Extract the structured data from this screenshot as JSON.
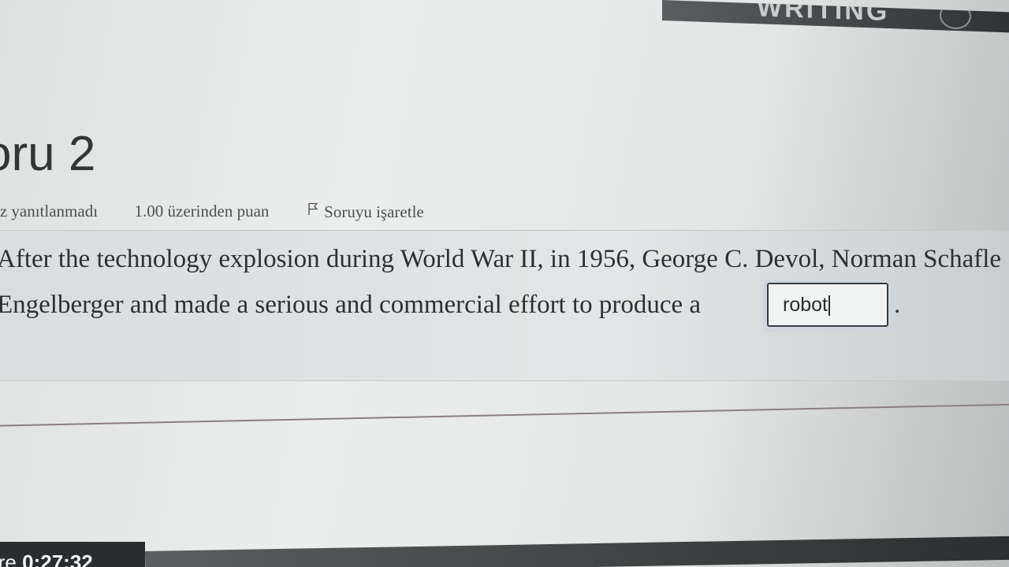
{
  "header": {
    "banner_text": "WRITING"
  },
  "question": {
    "title": "oru 2",
    "status": "iz yanıtlanmadı",
    "points": "1.00 üzerinden puan",
    "flag_label": "Soruyu işaretle",
    "line1": "After the technology explosion during World War II, in 1956, George C. Devol, Norman Schafle",
    "line2": "Engelberger and made a serious and commercial effort to produce a",
    "answer_value": "robot",
    "trailing": "."
  },
  "timer": {
    "label": "ire",
    "value": "0:27:32"
  },
  "icons": {
    "flag": "flag-icon",
    "header_logo": "logo-icon"
  }
}
